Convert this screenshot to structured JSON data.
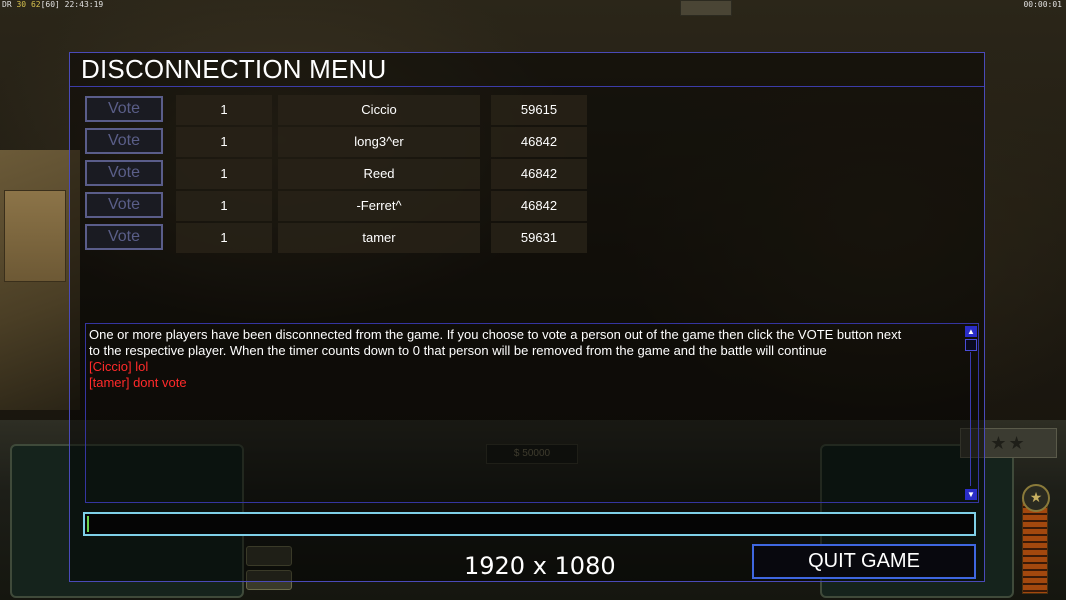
{
  "hud": {
    "fps_prefix": "DR",
    "fps_a": "30",
    "fps_b": "62",
    "fps_c": "[60]",
    "clock": "22:43:19",
    "game_timer": "00:00:01"
  },
  "command_bar": {
    "money": "$ 50000",
    "rank_stars": "★★",
    "general_icon": "★"
  },
  "dialog": {
    "title": "DISCONNECTION MENU",
    "vote_label": "Vote",
    "players": [
      {
        "slot": "1",
        "name": "Ciccio",
        "ping": "59615"
      },
      {
        "slot": "1",
        "name": "long3^er",
        "ping": "46842"
      },
      {
        "slot": "1",
        "name": "Reed",
        "ping": "46842"
      },
      {
        "slot": "1",
        "name": "-Ferret^",
        "ping": "46842"
      },
      {
        "slot": "1",
        "name": "tamer",
        "ping": "59631"
      }
    ],
    "chat": {
      "info_line_1": "One or more players have been disconnected from the game. If you choose to vote a person out of the game then click the VOTE button next",
      "info_line_2": " to the respective player. When the timer counts down to 0 that person will be removed from the game and the battle will continue",
      "messages": [
        "[Ciccio] lol",
        "[tamer] dont vote"
      ]
    },
    "chat_input_value": "",
    "quit_label": "QUIT GAME"
  },
  "overlay_resolution": "1920 x 1080",
  "colors": {
    "dialog_border": "#4a4ab8",
    "chat_message": "#ff2a2a",
    "quit_border": "#3f67e0",
    "input_border": "#7fd0e8"
  }
}
